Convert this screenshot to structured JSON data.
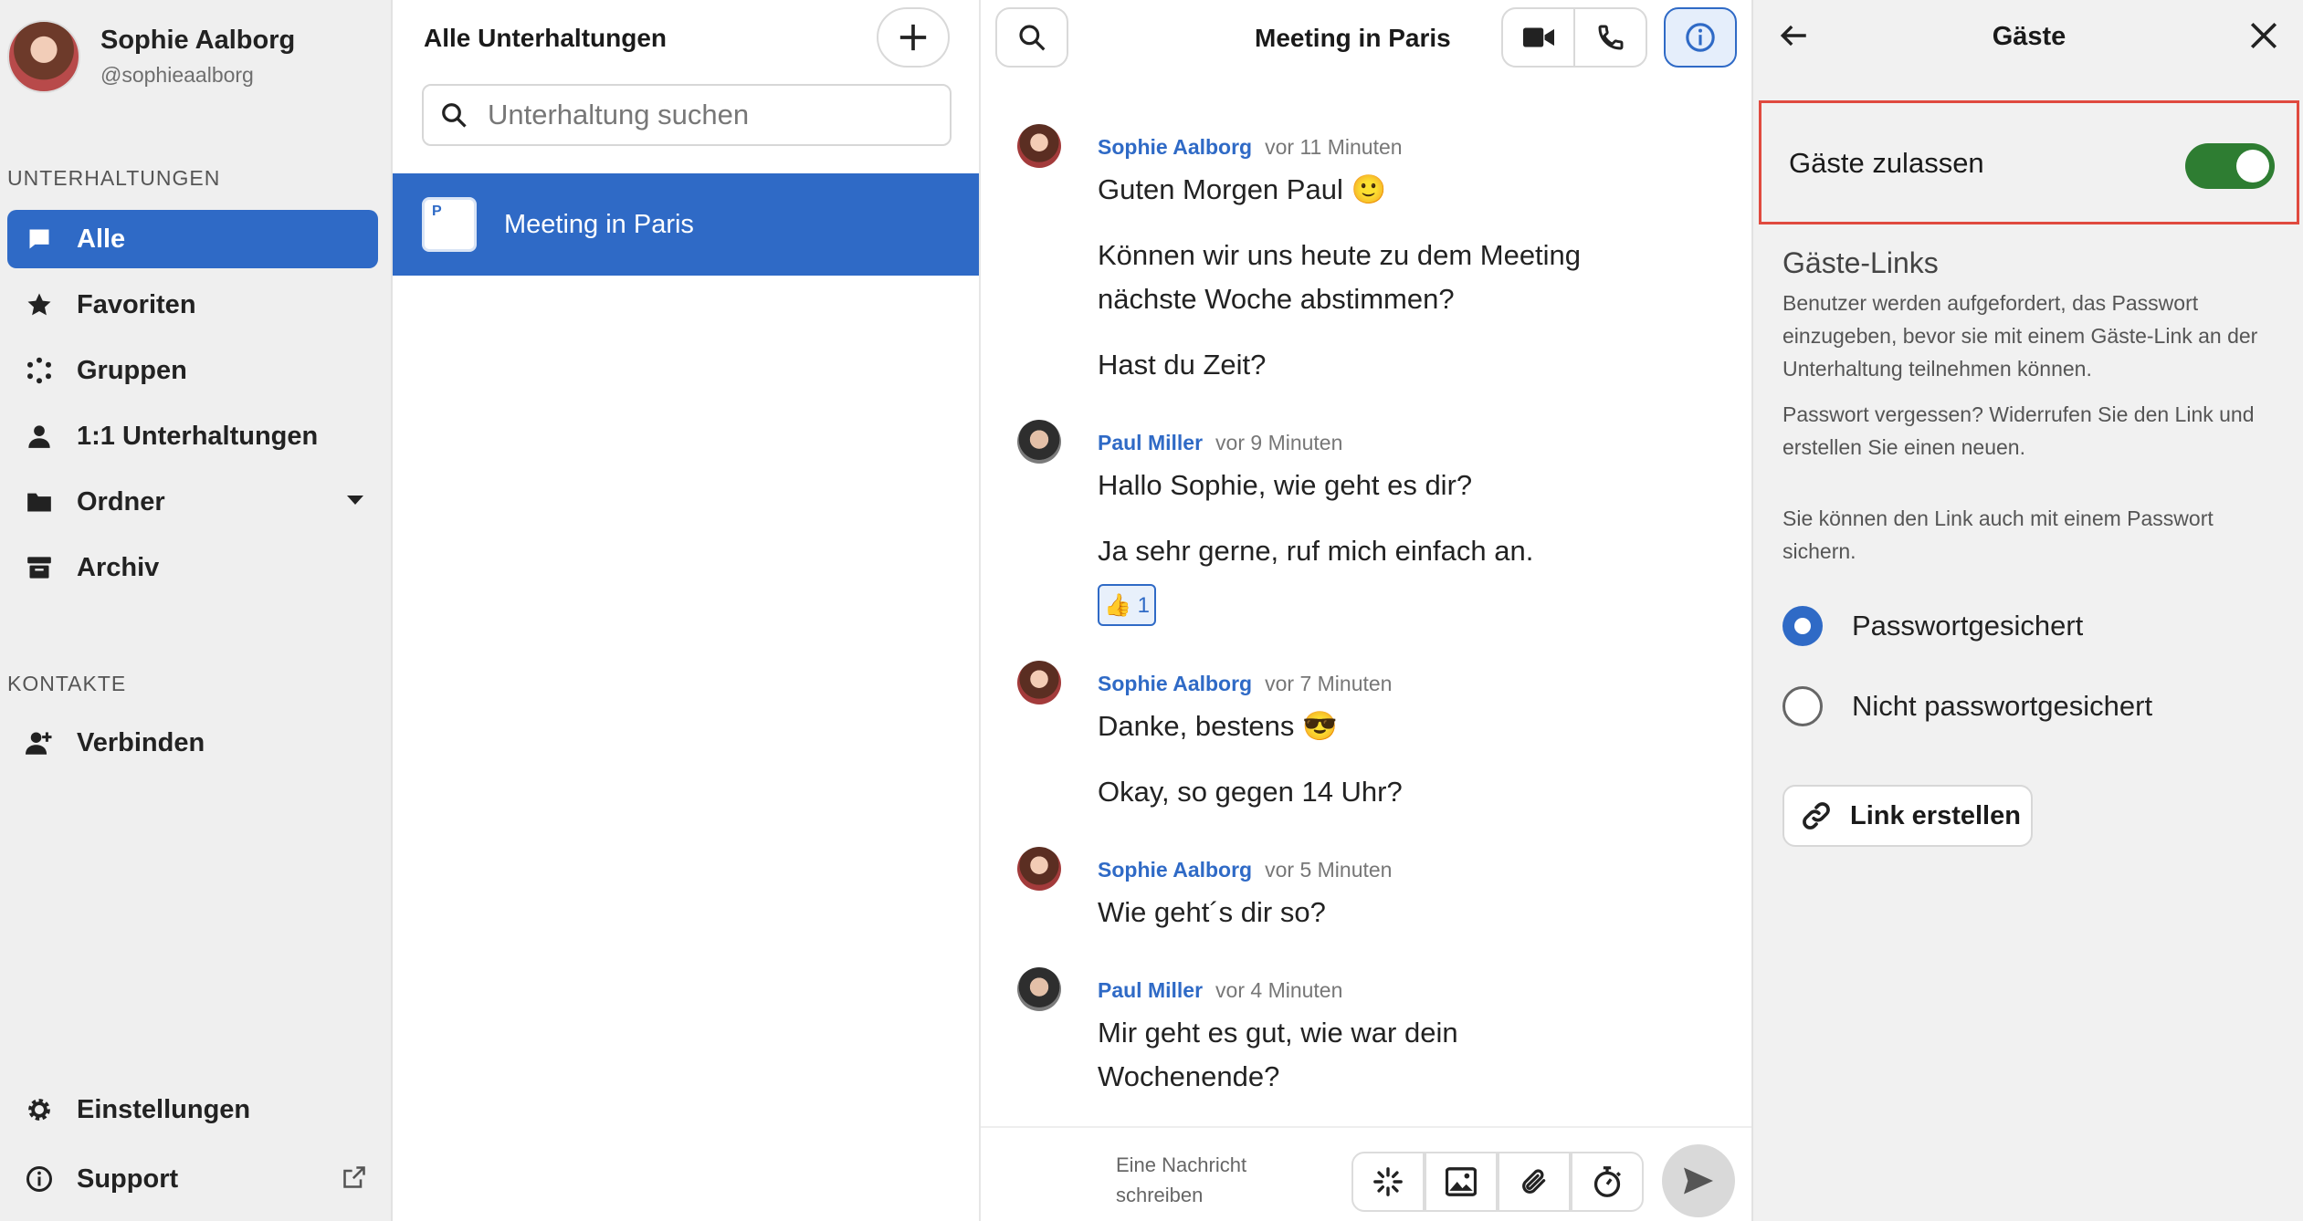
{
  "user": {
    "name": "Sophie Aalborg",
    "handle": "@sophieaalborg"
  },
  "sidebar": {
    "section_conversations": "UNTERHALTUNGEN",
    "items": [
      {
        "label": "Alle",
        "icon": "chat-bubble-icon",
        "active": true
      },
      {
        "label": "Favoriten",
        "icon": "star-icon"
      },
      {
        "label": "Gruppen",
        "icon": "group-dots-icon"
      },
      {
        "label": "1:1 Unterhaltungen",
        "icon": "person-icon"
      },
      {
        "label": "Ordner",
        "icon": "folder-icon"
      },
      {
        "label": "Archiv",
        "icon": "archive-icon"
      }
    ],
    "section_contacts": "KONTAKTE",
    "connect_label": "Verbinden",
    "settings_label": "Einstellungen",
    "support_label": "Support"
  },
  "conversations": {
    "title": "Alle Unterhaltungen",
    "search_placeholder": "Unterhaltung suchen",
    "items": [
      {
        "name": "Meeting in Paris",
        "initial": "P"
      }
    ]
  },
  "chat": {
    "title": "Meeting in Paris",
    "messages": [
      {
        "author": "Sophie Aalborg",
        "time": "vor 11 Minuten",
        "lines": [
          "Guten Morgen Paul 🙂",
          "Können wir uns heute zu dem Meeting nächste Woche abstimmen?",
          "Hast du Zeit?"
        ]
      },
      {
        "author": "Paul Miller",
        "time": "vor 9 Minuten",
        "lines": [
          "Hallo Sophie, wie geht es dir?",
          "Ja sehr gerne, ruf mich einfach an."
        ],
        "reaction": "👍 1"
      },
      {
        "author": "Sophie Aalborg",
        "time": "vor 7 Minuten",
        "lines": [
          "Danke, bestens 😎",
          "Okay, so gegen 14 Uhr?"
        ]
      },
      {
        "author": "Sophie Aalborg",
        "time": "vor 5 Minuten",
        "lines": [
          "Wie geht´s dir so?"
        ]
      },
      {
        "author": "Paul Miller",
        "time": "vor 4 Minuten",
        "lines": [
          "Mir geht es gut, wie war dein Wochenende?"
        ]
      }
    ],
    "composer_placeholder": "Eine Nachricht schreiben"
  },
  "panel": {
    "title": "Gäste",
    "allow_guests_label": "Gäste zulassen",
    "allow_guests_enabled": true,
    "links_heading": "Gäste-Links",
    "desc1": "Benutzer werden aufgefordert, das Passwort einzugeben, bevor sie mit einem Gäste-Link an der Unterhaltung teilnehmen können.",
    "desc2": "Passwort vergessen? Widerrufen Sie den Link und erstellen Sie einen neuen.",
    "desc3": "Sie können den Link auch mit einem Passwort sichern.",
    "option_protected": "Passwortgesichert",
    "option_unprotected": "Nicht passwortgesichert",
    "selected_option": "Passwortgesichert",
    "create_link_label": "Link erstellen"
  },
  "colors": {
    "accent": "#2f6ac6",
    "toggle_on": "#2e7d32",
    "highlight_border": "#e04a3f"
  }
}
